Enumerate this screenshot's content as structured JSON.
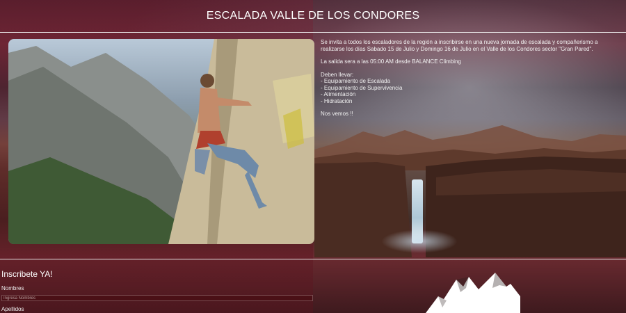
{
  "header": {
    "title": "ESCALADA VALLE DE LOS CONDORES"
  },
  "event": {
    "invite": "Se invita a todos los escaladores de la región a inscribirse en una nueva jornada de escalada y compañerismo a realizarse los días Sabado 15 de Julio y Domingo 16 de Julio en el Valle de los Condores sector \"Gran Pared\".",
    "departure": "La salida sera a las 05:00 AM desde BALANCE Climbing",
    "bring_heading": "Deben llevar:",
    "bring_items": [
      "- Equipamiento de Escalada",
      "- Equipamiento de Supervivencia",
      "- Alimentación",
      "- Hidratación"
    ],
    "closing": "Nos vemos !!"
  },
  "form": {
    "title": "Inscribete YA!",
    "names_label": "Nombres",
    "names_placeholder": "Ingresa Nombres",
    "lastname_label": "Apellidos"
  },
  "icons": {
    "logo": "mountain-logo-icon"
  },
  "colors": {
    "rule": "#f2f2f2",
    "text": "#ffffff"
  }
}
